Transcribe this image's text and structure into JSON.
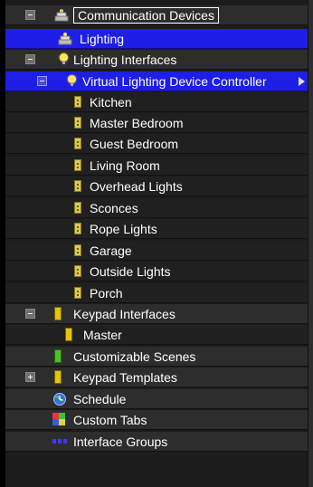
{
  "tree": {
    "communication_devices": "Communication Devices",
    "lighting": "Lighting",
    "lighting_interfaces": "Lighting Interfaces",
    "virtual_controller": "Virtual Lighting Device Controller",
    "loads": [
      "Kitchen",
      "Master Bedroom",
      "Guest Bedroom",
      "Living Room",
      "Overhead Lights",
      "Sconces",
      "Rope Lights",
      "Garage",
      "Outside Lights",
      "Porch"
    ],
    "keypad_interfaces": "Keypad Interfaces",
    "master": "Master",
    "customizable_scenes": "Customizable Scenes",
    "keypad_templates": "Keypad Templates",
    "schedule": "Schedule",
    "custom_tabs": "Custom Tabs",
    "interface_groups": "Interface Groups"
  },
  "icons": {
    "communication_devices": "devices-icon",
    "lighting": "devices-icon",
    "lighting_interfaces": "bulb-icon",
    "virtual_controller": "bulb-icon",
    "load": "lighting-load-icon",
    "keypad": "keypad-icon",
    "scenes": "keypad-icon",
    "schedule": "globe-clock-icon",
    "custom_tabs": "tabs-icon",
    "interface_groups": "groups-icon"
  },
  "colors": {
    "selection": "#1e1ee6",
    "panel": "#1c1c1c",
    "text": "#ffffff"
  }
}
